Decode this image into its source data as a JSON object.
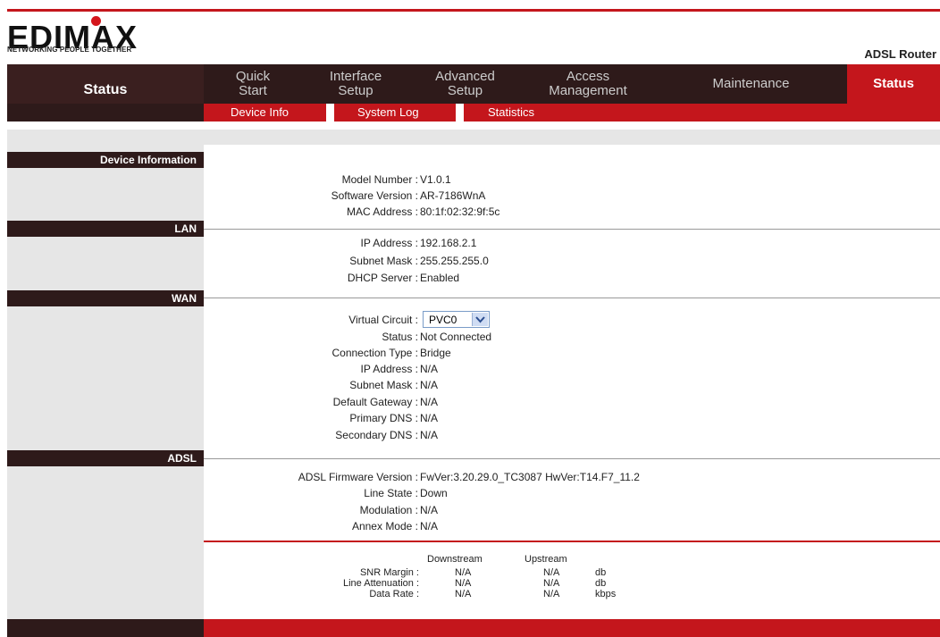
{
  "brand": {
    "logo_text": "EDIMAX",
    "tagline": "NETWORKING PEOPLE TOGETHER",
    "product": "ADSL Router",
    "accent_color": "#c4161c",
    "dark_color": "#2e1a1a"
  },
  "nav": {
    "section_title": "Status",
    "tabs": [
      {
        "label": "Quick\nStart"
      },
      {
        "label": "Interface\nSetup"
      },
      {
        "label": "Advanced\nSetup"
      },
      {
        "label": "Access\nManagement"
      },
      {
        "label": "Maintenance"
      },
      {
        "label": "Status"
      }
    ],
    "subtabs": [
      "Device Info",
      "System Log",
      "Statistics"
    ]
  },
  "sections": {
    "device": {
      "title": "Device Information",
      "rows": [
        {
          "label": "Model Number :",
          "value": "V1.0.1"
        },
        {
          "label": "Software Version :",
          "value": "AR-7186WnA"
        },
        {
          "label": "MAC Address :",
          "value": "80:1f:02:32:9f:5c"
        }
      ]
    },
    "lan": {
      "title": "LAN",
      "rows": [
        {
          "label": "IP Address :",
          "value": "192.168.2.1"
        },
        {
          "label": "Subnet Mask :",
          "value": "255.255.255.0"
        },
        {
          "label": "DHCP Server :",
          "value": "Enabled"
        }
      ]
    },
    "wan": {
      "title": "WAN",
      "virtual_circuit_label": "Virtual Circuit :",
      "virtual_circuit_value": "PVC0",
      "rows": [
        {
          "label": "Status :",
          "value": "Not Connected"
        },
        {
          "label": "Connection Type :",
          "value": "Bridge"
        },
        {
          "label": "IP Address :",
          "value": "N/A"
        },
        {
          "label": "Subnet Mask :",
          "value": "N/A"
        },
        {
          "label": "Default Gateway :",
          "value": "N/A"
        },
        {
          "label": "Primary DNS :",
          "value": "N/A"
        },
        {
          "label": "Secondary DNS :",
          "value": "N/A"
        }
      ]
    },
    "adsl": {
      "title": "ADSL",
      "rows": [
        {
          "label": "ADSL Firmware Version :",
          "value": "FwVer:3.20.29.0_TC3087 HwVer:T14.F7_11.2"
        },
        {
          "label": "Line State :",
          "value": "Down"
        },
        {
          "label": "Modulation :",
          "value": "N/A"
        },
        {
          "label": "Annex Mode :",
          "value": "N/A"
        }
      ],
      "stats": {
        "col_down": "Downstream",
        "col_up": "Upstream",
        "rows": [
          {
            "label": "SNR Margin :",
            "down": "N/A",
            "up": "N/A",
            "unit": "db"
          },
          {
            "label": "Line Attenuation :",
            "down": "N/A",
            "up": "N/A",
            "unit": "db"
          },
          {
            "label": "Data Rate :",
            "down": "N/A",
            "up": "N/A",
            "unit": "kbps"
          }
        ]
      }
    }
  }
}
